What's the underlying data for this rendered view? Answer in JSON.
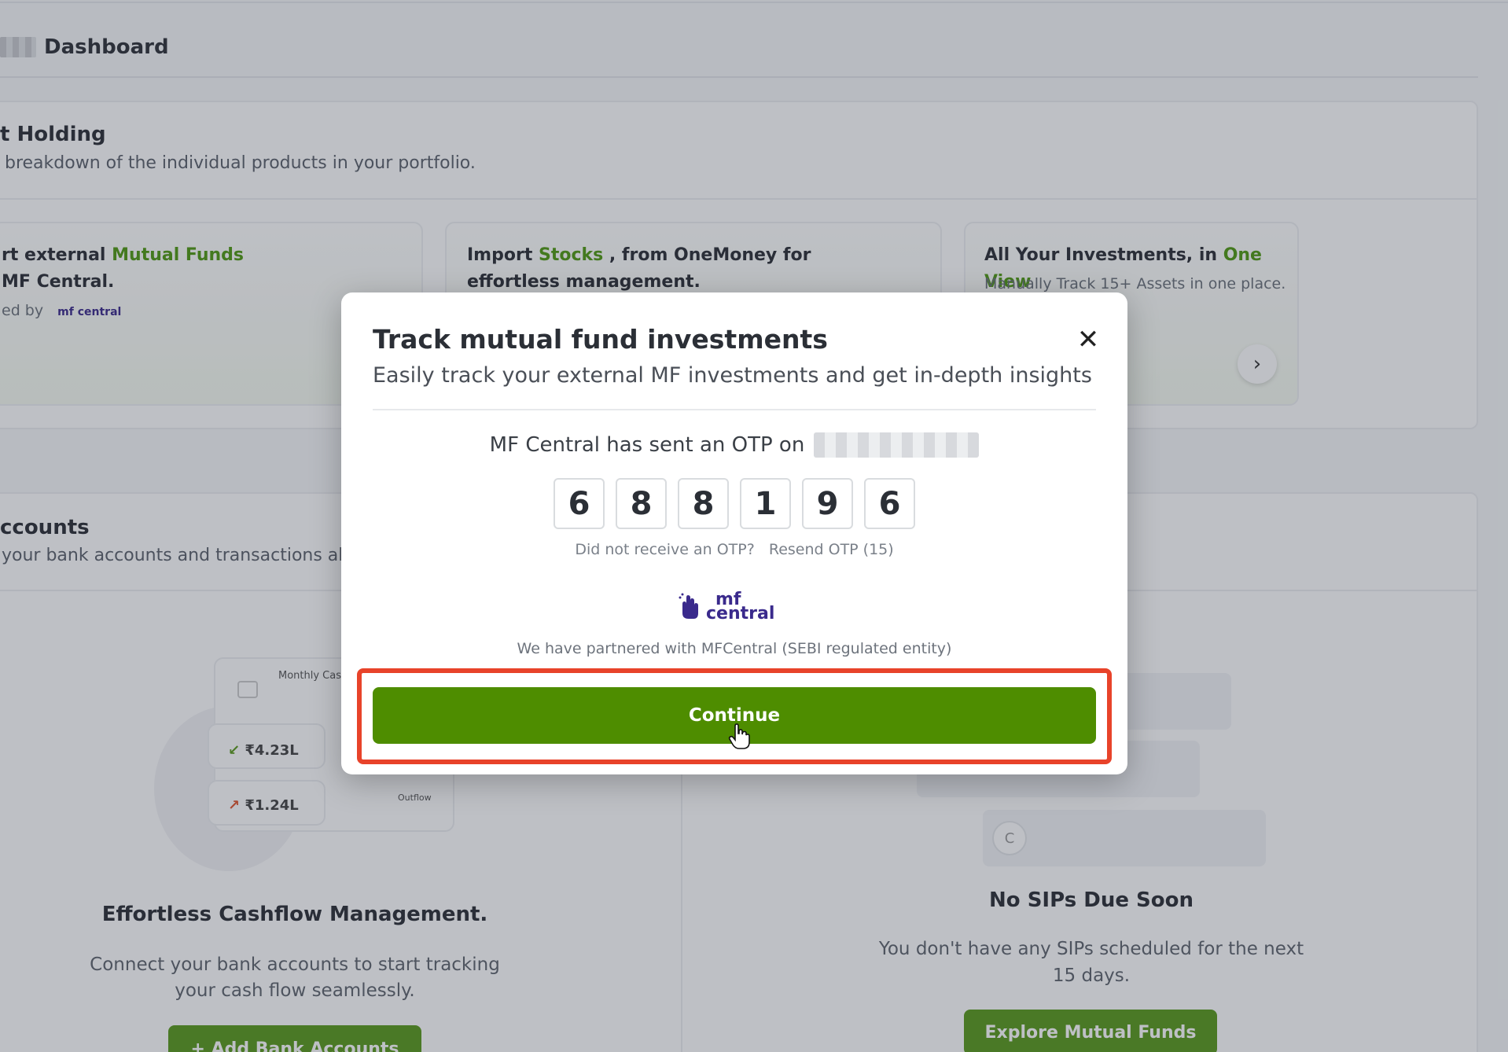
{
  "breadcrumb": {
    "label": "Dashboard"
  },
  "holding": {
    "title": "t Holding",
    "subtitle": "breakdown of the individual products in your portfolio."
  },
  "promo_cards": [
    {
      "line1_prefix": "rt external ",
      "line1_highlight": "Mutual Funds",
      "line2": "MF Central.",
      "powered_label": "ed by",
      "powered_logo": "mf central"
    },
    {
      "line1_prefix": "Import ",
      "line1_highlight": "Stocks",
      "line1_suffix": " , from OneMoney for",
      "line2": "effortless management."
    },
    {
      "line1_prefix": "All Your Investments, in ",
      "line1_highlight": "One View",
      "line2": "Manually Track 15+ Assets in one place.",
      "arrow_icon": "chevron-right-icon"
    }
  ],
  "accounts": {
    "title": "ccounts",
    "subtitle": "your bank accounts and transactions alo"
  },
  "cashflow": {
    "monthly_label": "Monthly Cash",
    "inflow": "₹4.23L",
    "outflow": "₹1.24L",
    "outflow_label": "Outflow",
    "heading": "Effortless Cashflow Management.",
    "sub1": "Connect your bank accounts to start tracking",
    "sub2": "your cash flow seamlessly.",
    "button": "+ Add Bank Accounts"
  },
  "sips": {
    "avatar_letter": "C",
    "heading": "No SIPs Due Soon",
    "sub1": "You don't have any SIPs scheduled for the next",
    "sub2": "15 days.",
    "button": "Explore Mutual Funds"
  },
  "modal": {
    "title": "Track mutual fund investments",
    "subtitle": "Easily track your external MF investments and get in-depth insights",
    "close_icon": "close-icon",
    "otp_sent_text": "MF Central has sent an OTP on",
    "otp_digits": [
      "6",
      "8",
      "8",
      "1",
      "9",
      "6"
    ],
    "not_received": "Did not receive an OTP?",
    "resend": "Resend OTP (15)",
    "logo_top": "mf",
    "logo_bottom": "central",
    "partner_text": "We have partnered with MFCentral (SEBI regulated entity)",
    "continue": "Continue"
  },
  "colors": {
    "accent": "#4e8d00",
    "highlight": "#e8432a",
    "brand_purple": "#3a2a8c"
  }
}
